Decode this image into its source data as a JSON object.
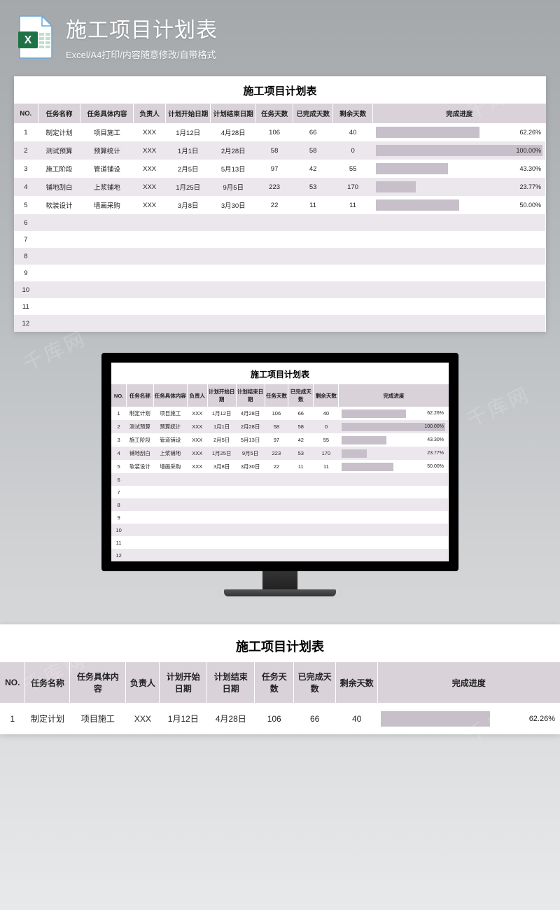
{
  "header": {
    "title": "施工项目计划表",
    "subtitle": "Excel/A4打印/内容随意修改/自带格式"
  },
  "sheet": {
    "title": "施工项目计划表",
    "columns": [
      "NO.",
      "任务名称",
      "任务具体内容",
      "负责人",
      "计划开始日期",
      "计划结束日期",
      "任务天数",
      "已完成天数",
      "剩余天数",
      "完成进度"
    ],
    "rows": [
      {
        "no": "1",
        "name": "制定计划",
        "detail": "项目施工",
        "owner": "XXX",
        "start": "1月12日",
        "end": "4月28日",
        "days": "106",
        "done": "66",
        "left": "40",
        "pct": 62.26,
        "pct_label": "62.26%"
      },
      {
        "no": "2",
        "name": "测试预算",
        "detail": "预算统计",
        "owner": "XXX",
        "start": "1月1日",
        "end": "2月28日",
        "days": "58",
        "done": "58",
        "left": "0",
        "pct": 100.0,
        "pct_label": "100.00%"
      },
      {
        "no": "3",
        "name": "施工阶段",
        "detail": "管道铺设",
        "owner": "XXX",
        "start": "2月5日",
        "end": "5月13日",
        "days": "97",
        "done": "42",
        "left": "55",
        "pct": 43.3,
        "pct_label": "43.30%"
      },
      {
        "no": "4",
        "name": "铺地刮白",
        "detail": "上浆铺地",
        "owner": "XXX",
        "start": "1月25日",
        "end": "9月5日",
        "days": "223",
        "done": "53",
        "left": "170",
        "pct": 23.77,
        "pct_label": "23.77%"
      },
      {
        "no": "5",
        "name": "软装设计",
        "detail": "墙画采购",
        "owner": "XXX",
        "start": "3月8日",
        "end": "3月30日",
        "days": "22",
        "done": "11",
        "left": "11",
        "pct": 50.0,
        "pct_label": "50.00%"
      },
      {
        "no": "6"
      },
      {
        "no": "7"
      },
      {
        "no": "8"
      },
      {
        "no": "9"
      },
      {
        "no": "10"
      },
      {
        "no": "11"
      },
      {
        "no": "12"
      }
    ]
  },
  "watermark": "千库网",
  "chart_data": {
    "type": "bar",
    "title": "完成进度",
    "categories": [
      "制定计划",
      "测试预算",
      "施工阶段",
      "铺地刮白",
      "软装设计"
    ],
    "values": [
      62.26,
      100.0,
      43.3,
      23.77,
      50.0
    ],
    "xlabel": "",
    "ylabel": "完成进度 (%)",
    "ylim": [
      0,
      100
    ]
  }
}
